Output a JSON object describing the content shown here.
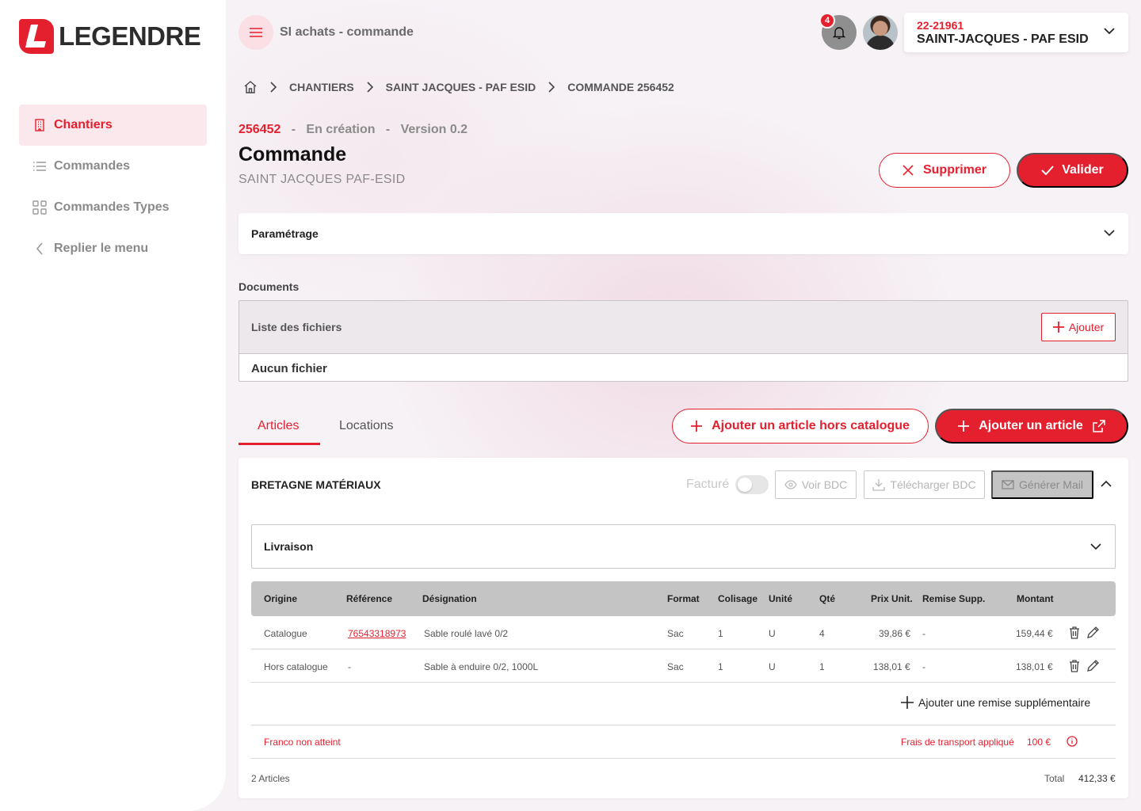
{
  "brand": {
    "name": "LEGENDRE",
    "accent": "#e4202f"
  },
  "sidebar": {
    "items": [
      {
        "label": "Chantiers",
        "icon": "building-icon",
        "active": true
      },
      {
        "label": "Commandes",
        "icon": "list-icon",
        "active": false
      },
      {
        "label": "Commandes Types",
        "icon": "grid-icon",
        "active": false
      },
      {
        "label": "Replier le menu",
        "icon": "chevron-left-icon",
        "active": false
      }
    ]
  },
  "header": {
    "app_title": "SI achats - commande",
    "notifications_count": "4",
    "site_code": "22-21961",
    "site_name": "SAINT-JACQUES - PAF ESID"
  },
  "breadcrumb": [
    "CHANTIERS",
    "SAINT JACQUES - PAF ESID",
    "COMMANDE 256452"
  ],
  "order": {
    "number": "256452",
    "status": "En création",
    "version": "Version 0.2",
    "title": "Commande",
    "subtitle": "SAINT JACQUES PAF-ESID",
    "delete_label": "Supprimer",
    "validate_label": "Valider"
  },
  "param": {
    "label": "Paramétrage"
  },
  "documents": {
    "section_label": "Documents",
    "list_label": "Liste des fichiers",
    "add_label": "Ajouter",
    "empty_label": "Aucun fichier"
  },
  "tabs": [
    {
      "label": "Articles",
      "active": true
    },
    {
      "label": "Locations",
      "active": false
    }
  ],
  "actions": {
    "add_off_catalog": "Ajouter un article hors catalogue",
    "add_article": "Ajouter un article"
  },
  "supplier": {
    "name": "BRETAGNE MATÉRIAUX",
    "facture_label": "Facturé",
    "voir_bdc": "Voir BDC",
    "telecharger_bdc": "Télécharger BDC",
    "generer_mail": "Générer Mail",
    "livraison_label": "Livraison",
    "columns": [
      "Origine",
      "Référence",
      "Désignation",
      "Format",
      "Colisage",
      "Unité",
      "Qté",
      "Prix Unit.",
      "Remise Supp.",
      "Montant"
    ],
    "rows": [
      {
        "origine": "Catalogue",
        "reference": "76543318973",
        "designation": "Sable roulé lavé 0/2",
        "format": "Sac",
        "colisage": "1",
        "unite": "U",
        "qte": "4",
        "prix": "39,86 €",
        "remise": "-",
        "montant": "159,44 €"
      },
      {
        "origine": "Hors catalogue",
        "reference": "-",
        "designation": "Sable à enduire 0/2, 1000L",
        "format": "Sac",
        "colisage": "1",
        "unite": "U",
        "qte": "1",
        "prix": "138,01 €",
        "remise": "-",
        "montant": "138,01 €"
      }
    ],
    "add_remise": "Ajouter une remise supplémentaire",
    "franco": "Franco non atteint",
    "frais_label": "Frais de transport appliqué",
    "frais_value": "100 €",
    "count": "2 Articles",
    "total_label": "Total",
    "total_value": "412,33 €"
  }
}
